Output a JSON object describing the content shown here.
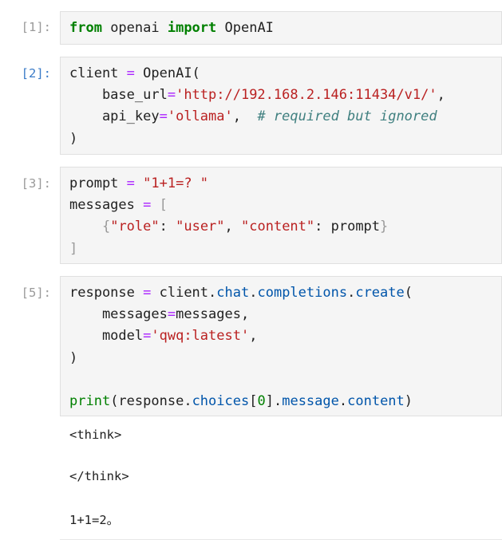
{
  "cells": [
    {
      "prompt": "[1]:",
      "lines": [
        [
          {
            "t": "from",
            "c": "kw"
          },
          {
            "t": " openai "
          },
          {
            "t": "import",
            "c": "kw"
          },
          {
            "t": " OpenAI"
          }
        ]
      ]
    },
    {
      "prompt": "[2]:",
      "lines": [
        [
          {
            "t": "client "
          },
          {
            "t": "=",
            "c": "op"
          },
          {
            "t": " OpenAI("
          }
        ],
        [
          {
            "t": "    base_url"
          },
          {
            "t": "=",
            "c": "op"
          },
          {
            "t": "'http://192.168.2.146:11434/v1/'",
            "c": "str"
          },
          {
            "t": ","
          }
        ],
        [
          {
            "t": "    api_key"
          },
          {
            "t": "=",
            "c": "op"
          },
          {
            "t": "'ollama'",
            "c": "str"
          },
          {
            "t": ",  "
          },
          {
            "t": "# required but ignored",
            "c": "cm"
          }
        ],
        [
          {
            "t": ")"
          }
        ]
      ]
    },
    {
      "prompt": "[3]:",
      "lines": [
        [
          {
            "t": "prompt "
          },
          {
            "t": "=",
            "c": "op"
          },
          {
            "t": " "
          },
          {
            "t": "\"1+1=? \"",
            "c": "str"
          }
        ],
        [
          {
            "t": "messages "
          },
          {
            "t": "=",
            "c": "op"
          },
          {
            "t": " "
          },
          {
            "t": "[",
            "c": "br"
          }
        ],
        [
          {
            "t": "    "
          },
          {
            "t": "{",
            "c": "br"
          },
          {
            "t": "\"role\"",
            "c": "str"
          },
          {
            "t": ": "
          },
          {
            "t": "\"user\"",
            "c": "str"
          },
          {
            "t": ", "
          },
          {
            "t": "\"content\"",
            "c": "str"
          },
          {
            "t": ": prompt"
          },
          {
            "t": "}",
            "c": "br"
          }
        ],
        [
          {
            "t": "]",
            "c": "br"
          }
        ]
      ]
    },
    {
      "prompt": "[5]:",
      "lines": [
        [
          {
            "t": "response "
          },
          {
            "t": "=",
            "c": "op"
          },
          {
            "t": " client"
          },
          {
            "t": "."
          },
          {
            "t": "chat",
            "c": "at"
          },
          {
            "t": "."
          },
          {
            "t": "completions",
            "c": "at"
          },
          {
            "t": "."
          },
          {
            "t": "create",
            "c": "at"
          },
          {
            "t": "("
          }
        ],
        [
          {
            "t": "    messages"
          },
          {
            "t": "=",
            "c": "op"
          },
          {
            "t": "messages,"
          }
        ],
        [
          {
            "t": "    model"
          },
          {
            "t": "=",
            "c": "op"
          },
          {
            "t": "'qwq:latest'",
            "c": "str"
          },
          {
            "t": ","
          }
        ],
        [
          {
            "t": ")"
          }
        ],
        [
          {
            "t": ""
          }
        ],
        [
          {
            "t": "print",
            "c": "fn"
          },
          {
            "t": "(response"
          },
          {
            "t": "."
          },
          {
            "t": "choices",
            "c": "at"
          },
          {
            "t": "["
          },
          {
            "t": "0",
            "c": "num"
          },
          {
            "t": "]"
          },
          {
            "t": "."
          },
          {
            "t": "message",
            "c": "at"
          },
          {
            "t": "."
          },
          {
            "t": "content",
            "c": "at"
          },
          {
            "t": ")"
          }
        ]
      ],
      "output": [
        "<think>",
        "",
        "</think>",
        "",
        "1+1=2。"
      ]
    }
  ]
}
